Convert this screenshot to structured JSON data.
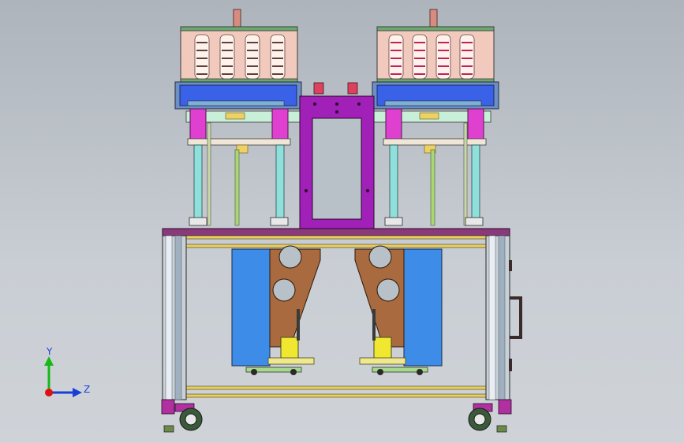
{
  "viewport": {
    "background_top": "#aeb4bc",
    "background_bottom": "#cfd3d8"
  },
  "triad": {
    "y_label": "Y",
    "z_label": "Z",
    "y_color": "#18b818",
    "z_color": "#1a3fd6",
    "x_color": "#e01010"
  },
  "model": {
    "colors": {
      "heater_box": "#f2c9bd",
      "heater_frame": "#6aa86f",
      "platen_blue": "#3a62e8",
      "cylinder_magenta": "#e040d0",
      "center_plate": "#a020b8",
      "column_cyan": "#8fe0dc",
      "frame_purple": "#7a2a6a",
      "table_yellow": "#e8d060",
      "panel_blue": "#3d8de8",
      "bracket_brown": "#a86a3e",
      "slide_yellow": "#f0e830",
      "frame_gray": "#b8c0c8"
    }
  }
}
